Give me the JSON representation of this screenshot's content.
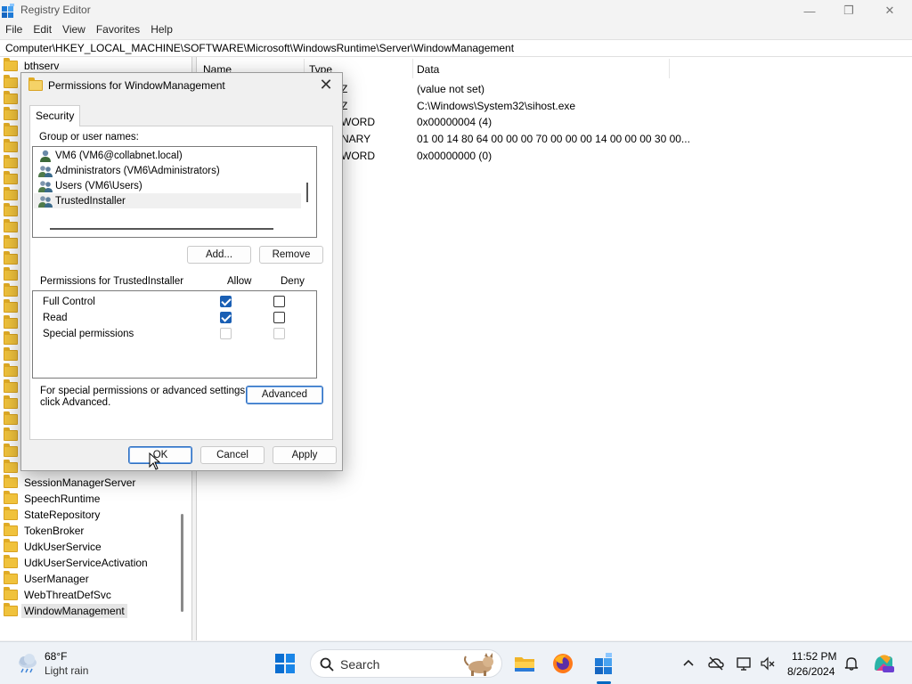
{
  "window": {
    "title": "Registry Editor",
    "minimize_glyph": "—",
    "maximize_glyph": "❐",
    "close_glyph": "✕"
  },
  "menu": [
    "File",
    "Edit",
    "View",
    "Favorites",
    "Help"
  ],
  "address": "Computer\\HKEY_LOCAL_MACHINE\\SOFTWARE\\Microsoft\\WindowsRuntime\\Server\\WindowManagement",
  "tree": {
    "top_item": "bthserv",
    "items": [
      "SessionManagerServer",
      "SpeechRuntime",
      "StateRepository",
      "TokenBroker",
      "UdkUserService",
      "UdkUserServiceActivation",
      "UserManager",
      "WebThreatDefSvc",
      "WindowManagement"
    ],
    "selected": "WindowManagement"
  },
  "values_pane": {
    "headers": {
      "name": "Name",
      "type": "Type",
      "data": "Data"
    },
    "rows": [
      {
        "type_visible": "Z",
        "data": "(value not set)"
      },
      {
        "type_visible": "Z",
        "data": "C:\\Windows\\System32\\sihost.exe"
      },
      {
        "type_visible": "WORD",
        "data": "0x00000004 (4)"
      },
      {
        "type_visible": "NARY",
        "data": "01 00 14 80 64 00 00 00 70 00 00 00 14 00 00 00 30 00..."
      },
      {
        "type_visible": "WORD",
        "data": "0x00000000 (0)"
      }
    ]
  },
  "dialog": {
    "title": "Permissions for WindowManagement",
    "close_glyph": "✕",
    "tab": "Security",
    "group_label": "Group or user names:",
    "users": [
      {
        "name": "VM6 (VM6@collabnet.local)",
        "icon": "single-user-icon"
      },
      {
        "name": "Administrators (VM6\\Administrators)",
        "icon": "user-group-icon"
      },
      {
        "name": "Users (VM6\\Users)",
        "icon": "user-group-icon"
      },
      {
        "name": "TrustedInstaller",
        "icon": "user-group-icon"
      }
    ],
    "selected_user": "TrustedInstaller",
    "add_button": "Add...",
    "remove_button": "Remove",
    "perm_label": "Permissions for TrustedInstaller",
    "allow_label": "Allow",
    "deny_label": "Deny",
    "permissions": [
      {
        "name": "Full Control",
        "allow": "checked",
        "deny": "unchecked"
      },
      {
        "name": "Read",
        "allow": "checked",
        "deny": "unchecked"
      },
      {
        "name": "Special permissions",
        "allow": "disabled",
        "deny": "disabled"
      }
    ],
    "advanced_note": "For special permissions or advanced settings, click Advanced.",
    "advanced_note_line1": "For special permissions or advanced settings,",
    "advanced_note_line2": "click Advanced.",
    "advanced_button": "Advanced",
    "ok_button": "OK",
    "cancel_button": "Cancel",
    "apply_button": "Apply"
  },
  "taskbar": {
    "weather_temp": "68°F",
    "weather_desc": "Light rain",
    "search_placeholder": "Search",
    "time": "11:52 PM",
    "date": "8/26/2024"
  },
  "colors": {
    "accent": "#0067c0",
    "folder": "#f0c23c",
    "checkbox_checked": "#1a5fb4"
  }
}
